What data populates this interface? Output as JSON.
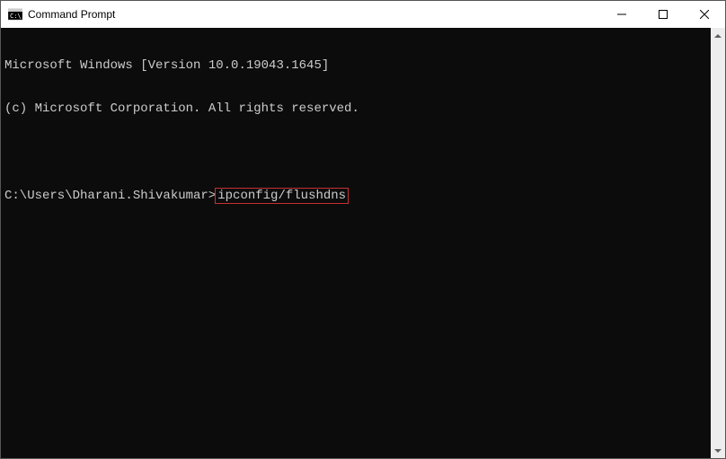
{
  "titlebar": {
    "title": "Command Prompt"
  },
  "terminal": {
    "line1": "Microsoft Windows [Version 10.0.19043.1645]",
    "line2": "(c) Microsoft Corporation. All rights reserved.",
    "prompt": "C:\\Users\\Dharani.Shivakumar>",
    "command": "ipconfig/flushdns"
  }
}
